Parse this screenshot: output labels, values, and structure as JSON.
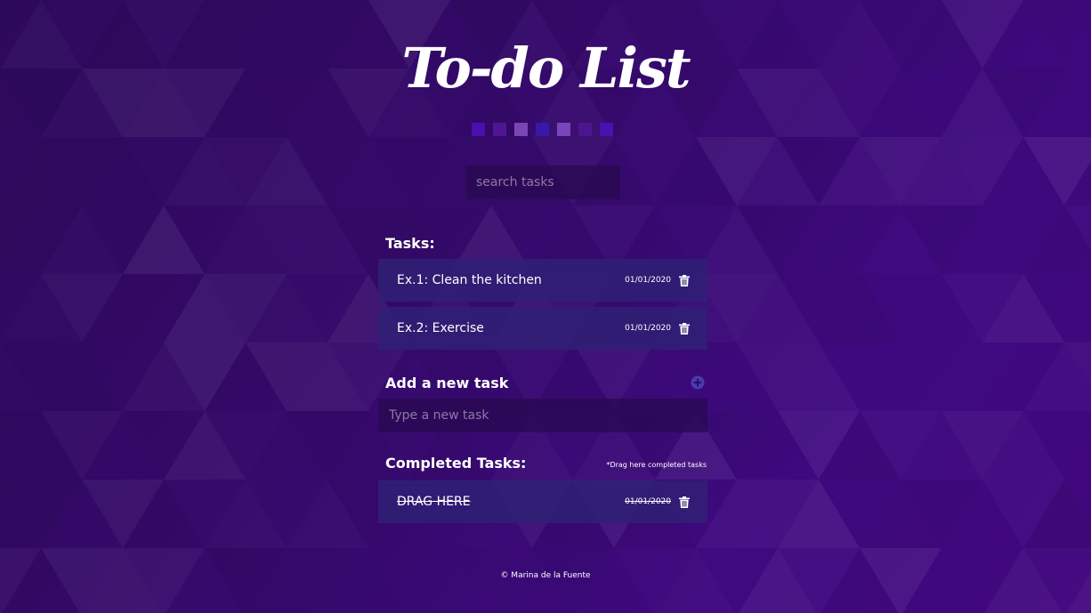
{
  "header": {
    "title": "To-do List"
  },
  "palette": {
    "colors": [
      "#4a0fae",
      "#4f1596",
      "#7a46b7",
      "#3718a9",
      "#7a45ba",
      "#4b1590",
      "#4612b0"
    ]
  },
  "search": {
    "placeholder": "search tasks"
  },
  "tasks": {
    "heading": "Tasks:",
    "items": [
      {
        "text": "Ex.1: Clean the kitchen",
        "date": "01/01/2020",
        "icon": "trash-icon"
      },
      {
        "text": "Ex.2: Exercise",
        "date": "01/01/2020",
        "icon": "trash-icon"
      }
    ]
  },
  "add_task": {
    "heading": "Add a new task",
    "icon": "plus-circle-icon",
    "placeholder": "Type a new task"
  },
  "completed": {
    "heading": "Completed Tasks:",
    "hint": "*Drag here completed tasks",
    "items": [
      {
        "text": "DRAG HERE",
        "date": "01/01/2020",
        "icon": "trash-icon"
      }
    ]
  },
  "footer": {
    "text": "© Marina de la Fuente"
  },
  "colors": {
    "background": "#350a6b",
    "card": "#302076",
    "input": "#280a50",
    "accent": "#4a3ab0"
  }
}
